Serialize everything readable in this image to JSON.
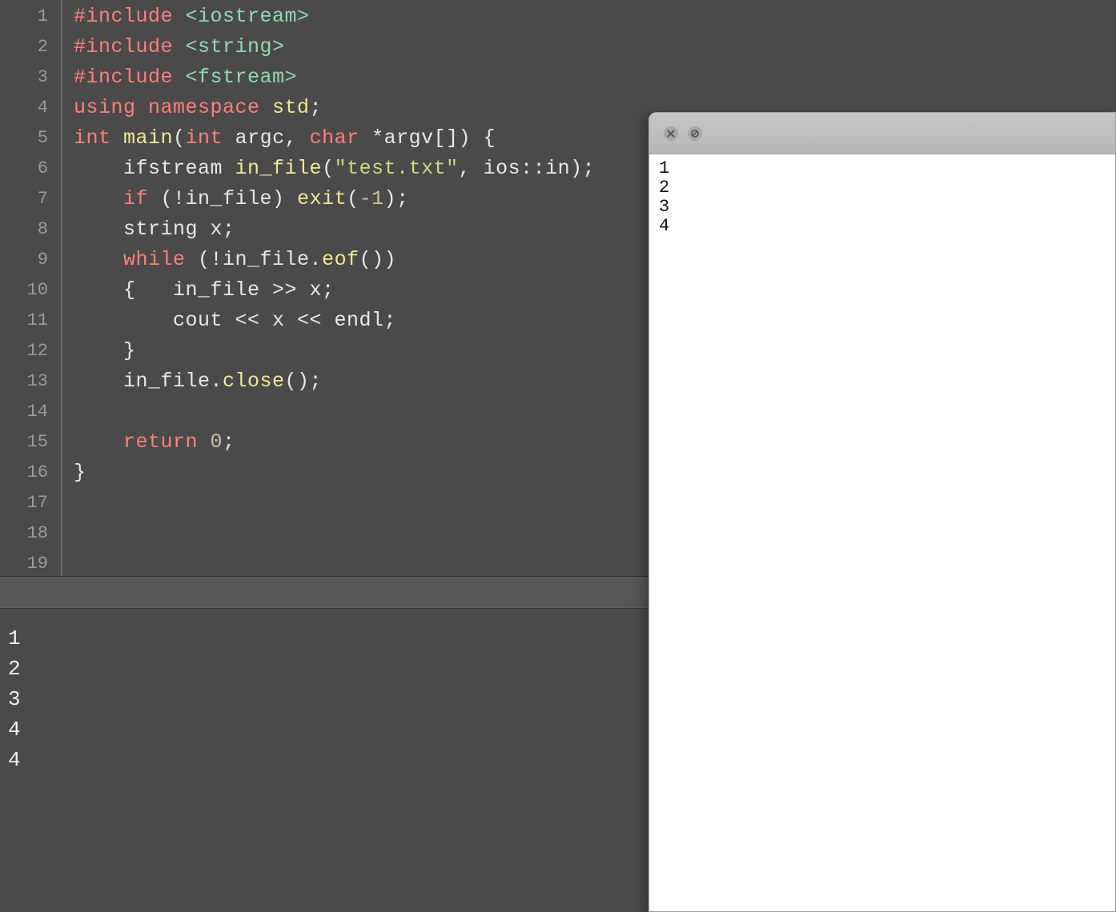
{
  "editor": {
    "line_numbers": [
      "1",
      "2",
      "3",
      "4",
      "5",
      "6",
      "7",
      "8",
      "9",
      "10",
      "11",
      "12",
      "13",
      "14",
      "15",
      "16",
      "17",
      "18",
      "19"
    ],
    "code_lines": [
      [
        {
          "t": "#include ",
          "c": "tok-kw"
        },
        {
          "t": "<iostream>",
          "c": "tok-hdr"
        }
      ],
      [
        {
          "t": "#include ",
          "c": "tok-kw"
        },
        {
          "t": "<string>",
          "c": "tok-hdr"
        }
      ],
      [
        {
          "t": "#include ",
          "c": "tok-kw"
        },
        {
          "t": "<fstream>",
          "c": "tok-hdr"
        }
      ],
      [
        {
          "t": "using namespace ",
          "c": "tok-kw"
        },
        {
          "t": "std",
          "c": "tok-fn"
        },
        {
          "t": ";",
          "c": "tok-pun"
        }
      ],
      [
        {
          "t": "int ",
          "c": "tok-kw"
        },
        {
          "t": "main",
          "c": "tok-fn"
        },
        {
          "t": "(",
          "c": "tok-pun"
        },
        {
          "t": "int ",
          "c": "tok-kw"
        },
        {
          "t": "argc, ",
          "c": "tok-id"
        },
        {
          "t": "char ",
          "c": "tok-kw"
        },
        {
          "t": "*argv[]) {",
          "c": "tok-id"
        }
      ],
      [
        {
          "t": "    ifstream ",
          "c": "tok-id"
        },
        {
          "t": "in_file",
          "c": "tok-fn"
        },
        {
          "t": "(",
          "c": "tok-pun"
        },
        {
          "t": "\"test.txt\"",
          "c": "tok-str"
        },
        {
          "t": ", ios::in);",
          "c": "tok-id"
        }
      ],
      [
        {
          "t": "    ",
          "c": "tok-id"
        },
        {
          "t": "if ",
          "c": "tok-kw"
        },
        {
          "t": "(!in_file) ",
          "c": "tok-id"
        },
        {
          "t": "exit",
          "c": "tok-fn"
        },
        {
          "t": "(",
          "c": "tok-pun"
        },
        {
          "t": "-1",
          "c": "tok-num"
        },
        {
          "t": ");",
          "c": "tok-pun"
        }
      ],
      [
        {
          "t": "    string x;",
          "c": "tok-id"
        }
      ],
      [
        {
          "t": "    ",
          "c": "tok-id"
        },
        {
          "t": "while ",
          "c": "tok-kw"
        },
        {
          "t": "(!in_file.",
          "c": "tok-id"
        },
        {
          "t": "eof",
          "c": "tok-fn"
        },
        {
          "t": "())",
          "c": "tok-pun"
        }
      ],
      [
        {
          "t": "    {   in_file >> x;",
          "c": "tok-id"
        }
      ],
      [
        {
          "t": "        cout << x << endl;",
          "c": "tok-id"
        }
      ],
      [
        {
          "t": "    }",
          "c": "tok-id"
        }
      ],
      [
        {
          "t": "    in_file.",
          "c": "tok-id"
        },
        {
          "t": "close",
          "c": "tok-fn"
        },
        {
          "t": "();",
          "c": "tok-pun"
        }
      ],
      [
        {
          "t": "",
          "c": "tok-id"
        }
      ],
      [
        {
          "t": "    ",
          "c": "tok-id"
        },
        {
          "t": "return ",
          "c": "tok-kw"
        },
        {
          "t": "0",
          "c": "tok-num"
        },
        {
          "t": ";",
          "c": "tok-pun"
        }
      ],
      [
        {
          "t": "}",
          "c": "tok-id"
        }
      ],
      [
        {
          "t": "",
          "c": "tok-id"
        }
      ],
      [
        {
          "t": "",
          "c": "tok-id"
        }
      ],
      [
        {
          "t": "",
          "c": "tok-id"
        }
      ]
    ]
  },
  "console": {
    "lines": [
      "1",
      "2",
      "3",
      "4",
      "4"
    ]
  },
  "text_file_window": {
    "close_icon": "close-circle-icon",
    "disabled_icon": "disabled-circle-icon",
    "content_lines": [
      "1",
      "2",
      "3",
      "4"
    ]
  }
}
